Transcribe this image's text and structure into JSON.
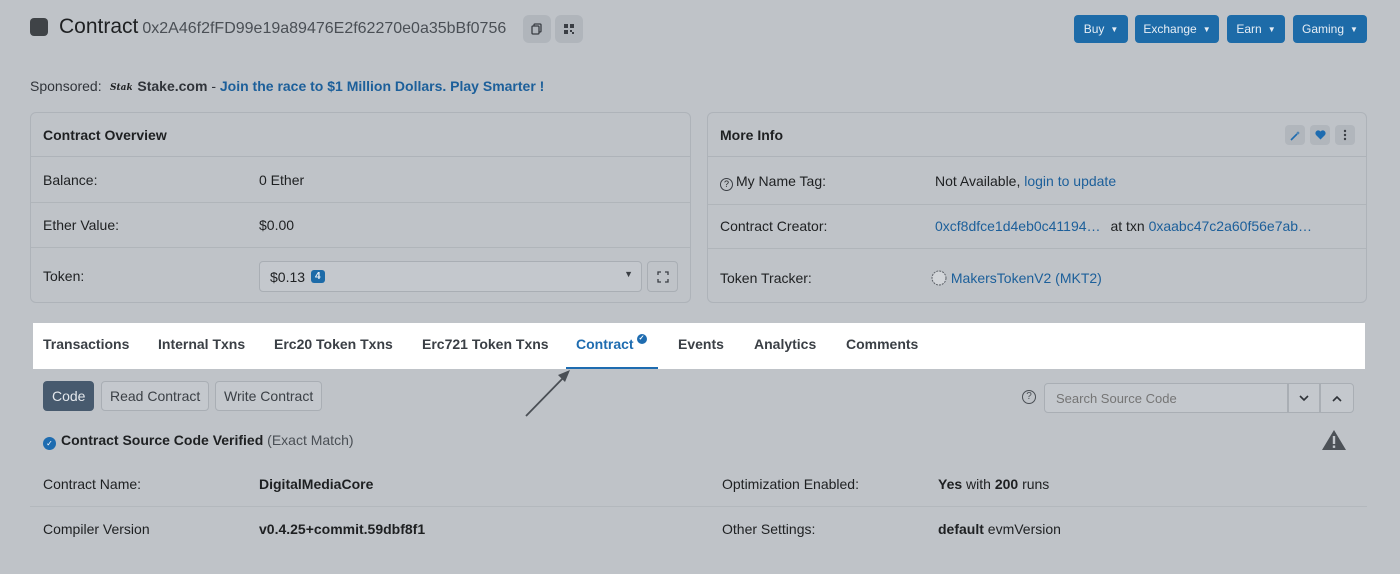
{
  "header": {
    "title": "Contract",
    "address": "0x2A46f2fFD99e19a89476E2f62270e0a35bBf0756",
    "nav": [
      {
        "label": "Buy"
      },
      {
        "label": "Exchange"
      },
      {
        "label": "Earn"
      },
      {
        "label": "Gaming"
      }
    ]
  },
  "sponsored": {
    "label": "Sponsored:",
    "brand": "Stake.com",
    "separator": " - ",
    "message": "Join the race to $1 Million Dollars. Play Smarter !"
  },
  "overview": {
    "title": "Contract Overview",
    "balance_label": "Balance:",
    "balance_value": "0 Ether",
    "ether_value_label": "Ether Value:",
    "ether_value": "$0.00",
    "token_label": "Token:",
    "token_value": "$0.13",
    "token_count": "4"
  },
  "more_info": {
    "title": "More Info",
    "name_tag_label": "My Name Tag:",
    "name_tag_value": "Not Available,",
    "name_tag_link": "login to update",
    "creator_label": "Contract Creator:",
    "creator_address": "0xcf8dfce1d4eb0c41194…",
    "creator_at_txn": "at txn",
    "creator_txn": "0xaabc47c2a60f56e7ab…",
    "tracker_label": "Token Tracker:",
    "tracker_value": "MakersTokenV2 (MKT2)"
  },
  "tabs": [
    {
      "label": "Transactions"
    },
    {
      "label": "Internal Txns"
    },
    {
      "label": "Erc20 Token Txns"
    },
    {
      "label": "Erc721 Token Txns"
    },
    {
      "label": "Contract"
    },
    {
      "label": "Events"
    },
    {
      "label": "Analytics"
    },
    {
      "label": "Comments"
    }
  ],
  "subtabs": [
    {
      "label": "Code"
    },
    {
      "label": "Read Contract"
    },
    {
      "label": "Write Contract"
    }
  ],
  "search": {
    "placeholder": "Search Source Code"
  },
  "verified": {
    "title": "Contract Source Code Verified",
    "match": "(Exact Match)"
  },
  "details": {
    "contract_name_label": "Contract Name:",
    "contract_name": "DigitalMediaCore",
    "compiler_label": "Compiler Version",
    "compiler_value": "v0.4.25+commit.59dbf8f1",
    "optimization_label": "Optimization Enabled:",
    "optimization_yes": "Yes",
    "optimization_with": " with ",
    "optimization_runs": "200",
    "optimization_suffix": " runs",
    "other_label": "Other Settings:",
    "other_default": "default",
    "other_suffix": " evmVersion"
  },
  "colors": {
    "accent": "#1e6cb0",
    "nav_button": "#1d6ba8",
    "overlay_bg": "#bfc3c8"
  }
}
